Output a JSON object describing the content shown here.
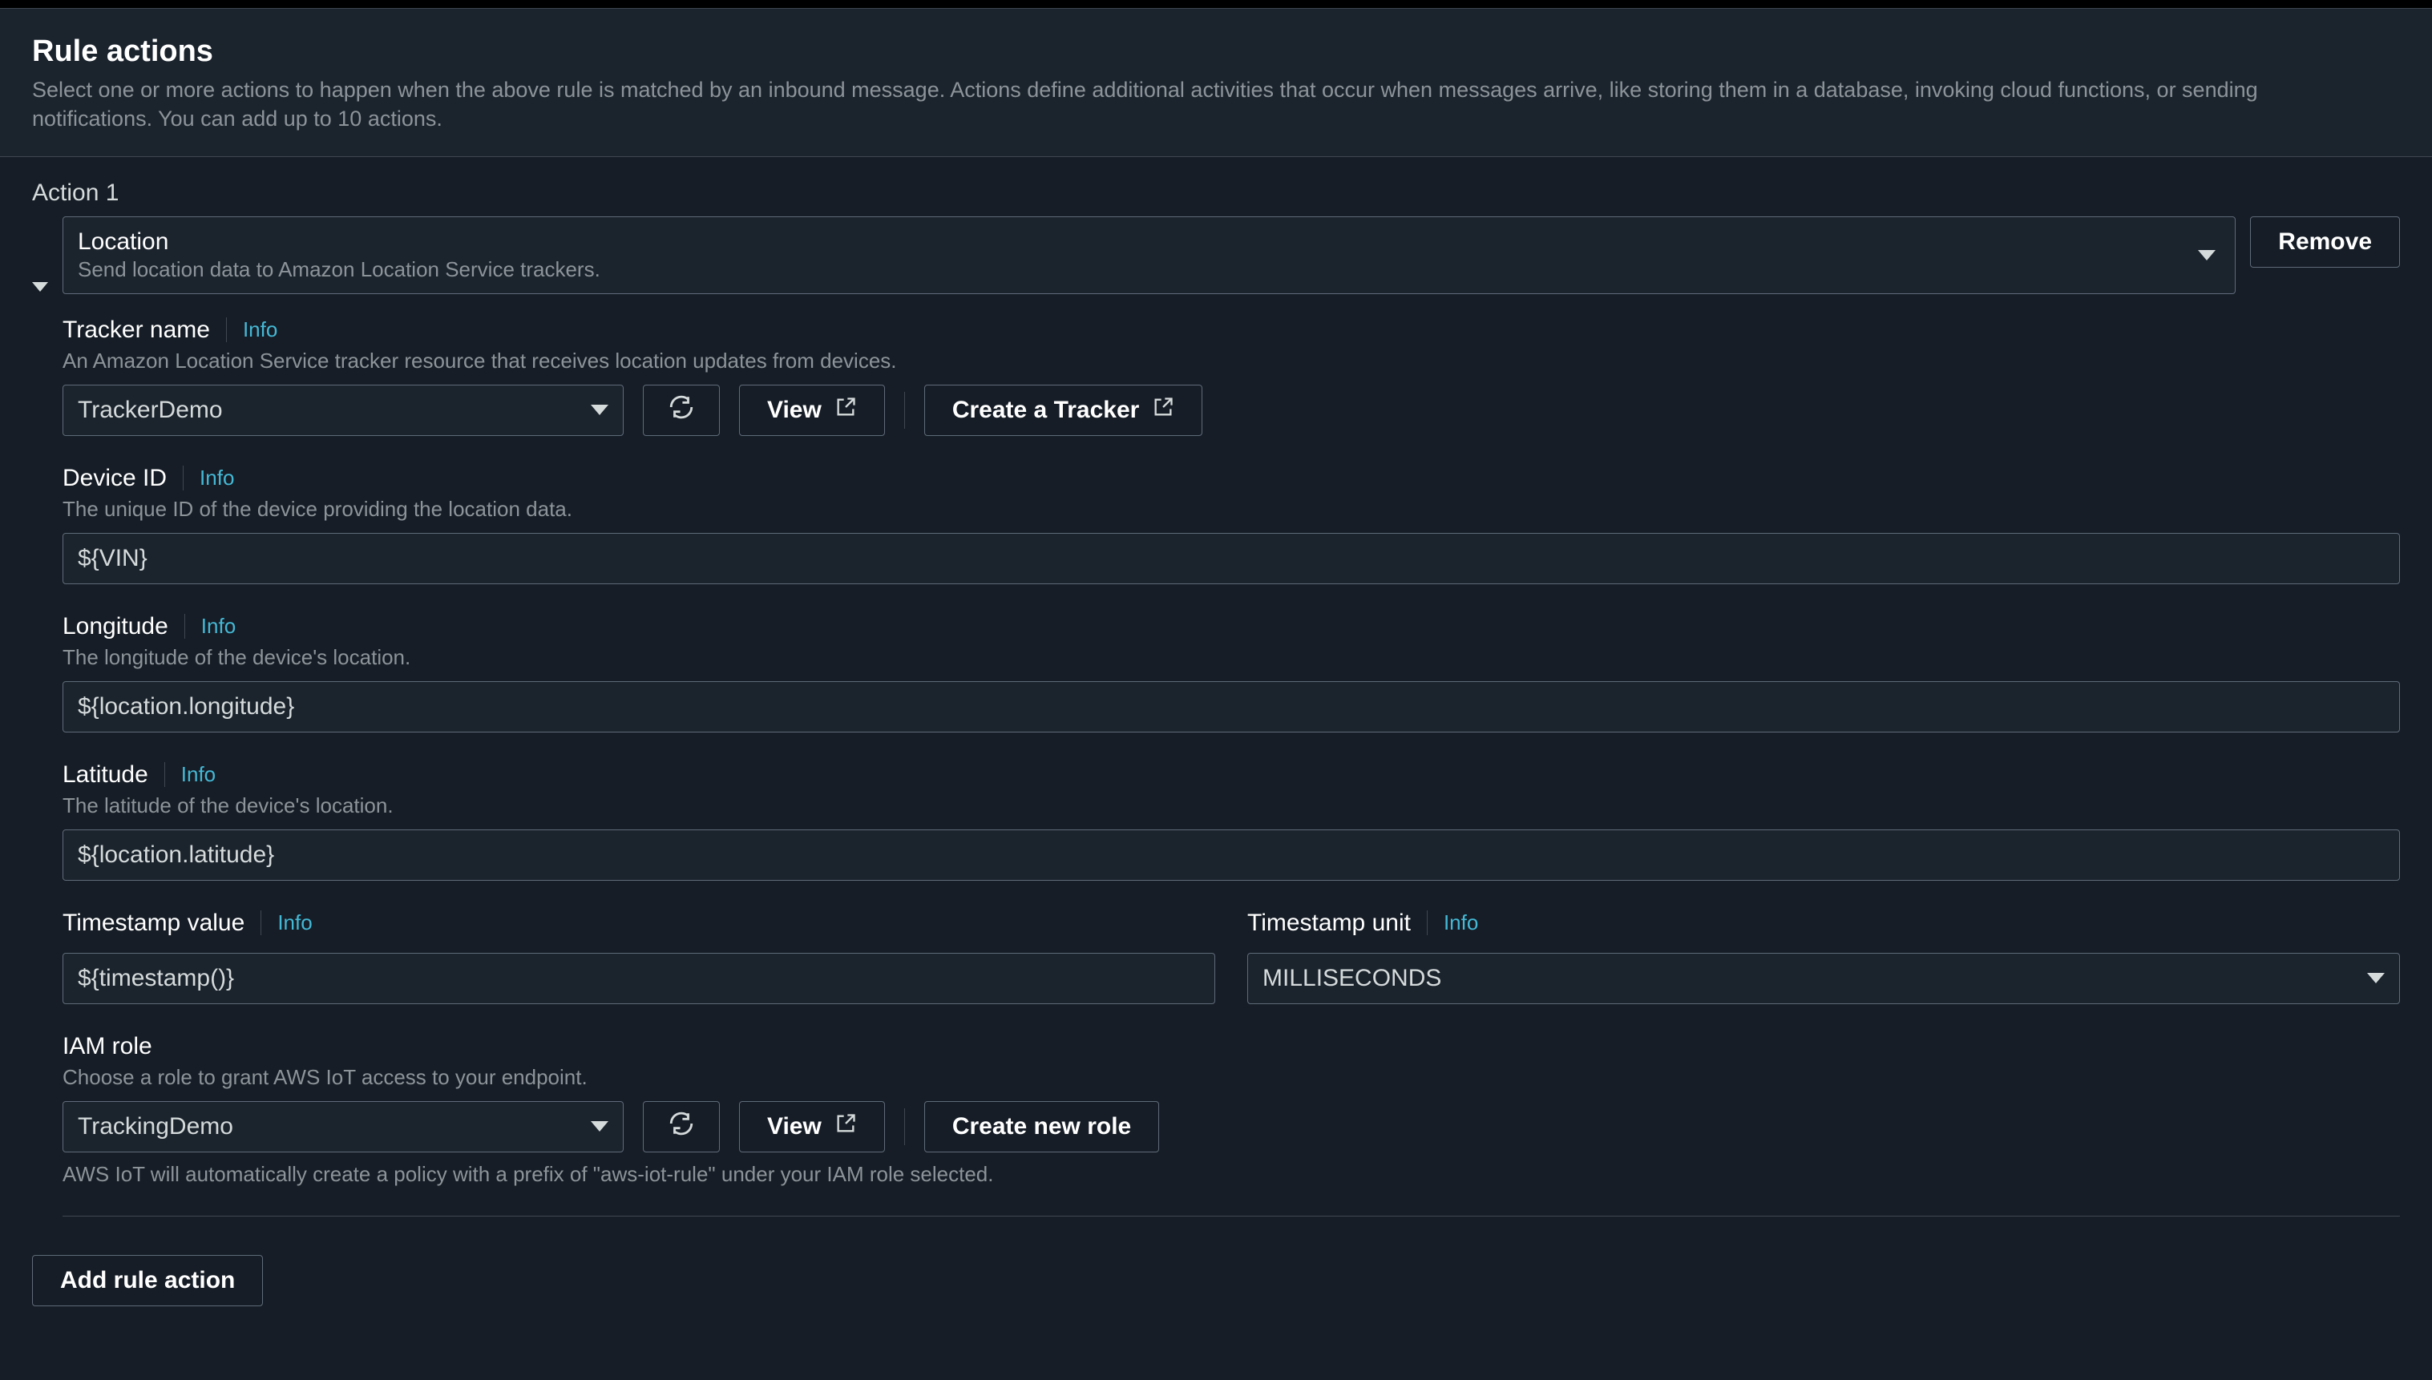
{
  "header": {
    "title": "Rule actions",
    "description": "Select one or more actions to happen when the above rule is matched by an inbound message. Actions define additional activities that occur when messages arrive, like storing them in a database, invoking cloud functions, or sending notifications. You can add up to 10 actions."
  },
  "action": {
    "label": "Action 1",
    "type_title": "Location",
    "type_subtitle": "Send location data to Amazon Location Service trackers.",
    "remove_label": "Remove"
  },
  "tracker": {
    "label": "Tracker name",
    "info": "Info",
    "description": "An Amazon Location Service tracker resource that receives location updates from devices.",
    "value": "TrackerDemo",
    "view_label": "View",
    "create_label": "Create a Tracker"
  },
  "device": {
    "label": "Device ID",
    "info": "Info",
    "description": "The unique ID of the device providing the location data.",
    "value": "${VIN}"
  },
  "longitude": {
    "label": "Longitude",
    "info": "Info",
    "description": "The longitude of the device's location.",
    "value": "${location.longitude}"
  },
  "latitude": {
    "label": "Latitude",
    "info": "Info",
    "description": "The latitude of the device's location.",
    "value": "${location.latitude}"
  },
  "timestamp_value": {
    "label": "Timestamp value",
    "info": "Info",
    "value": "${timestamp()}"
  },
  "timestamp_unit": {
    "label": "Timestamp unit",
    "info": "Info",
    "value": "MILLISECONDS"
  },
  "iam": {
    "label": "IAM role",
    "description": "Choose a role to grant AWS IoT access to your endpoint.",
    "value": "TrackingDemo",
    "view_label": "View",
    "create_label": "Create new role",
    "help": "AWS IoT will automatically create a policy with a prefix of \"aws-iot-rule\" under your IAM role selected."
  },
  "footer": {
    "add_action_label": "Add rule action"
  }
}
